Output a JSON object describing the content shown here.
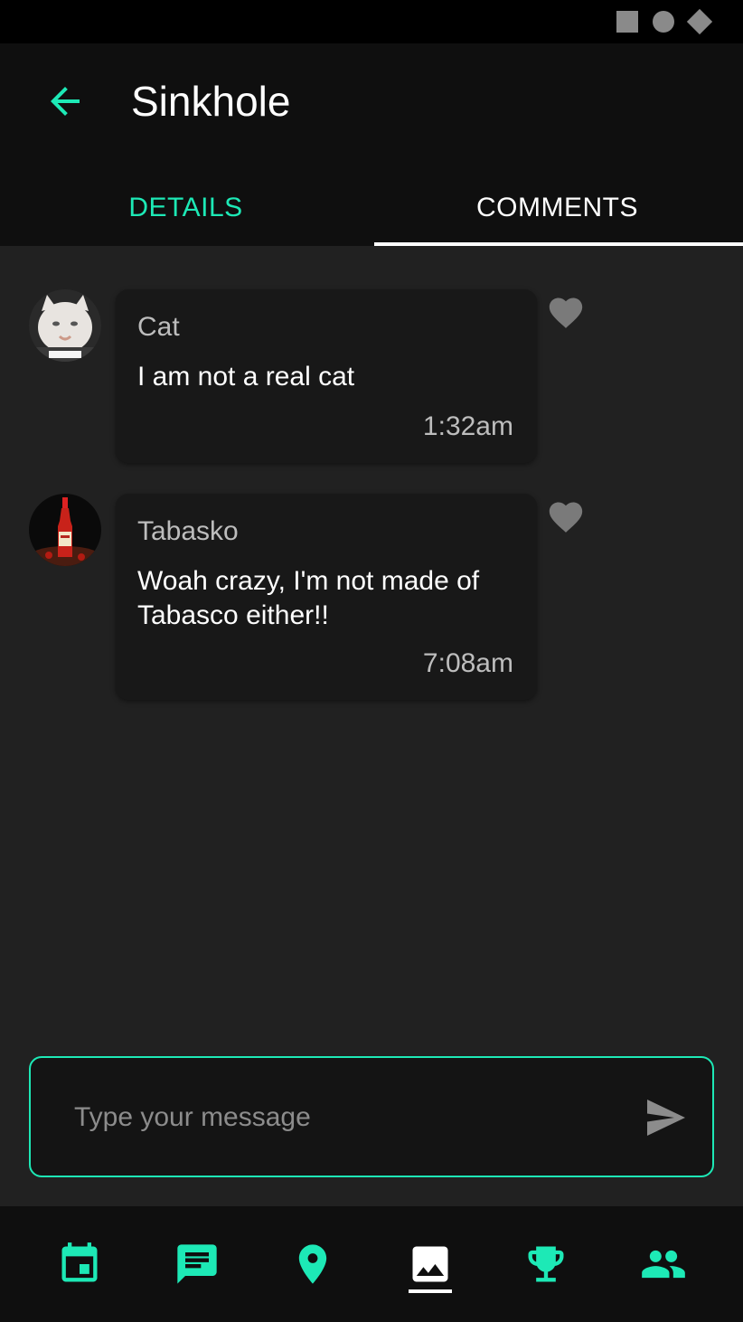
{
  "colors": {
    "accent": "#1de9b6",
    "background": "#212121",
    "card": "#181818",
    "bar": "#0f0f0f",
    "icon_muted": "#7a7a7a"
  },
  "header": {
    "title": "Sinkhole",
    "back_icon": "arrow-left-icon"
  },
  "tabs": [
    {
      "label": "DETAILS",
      "active": false
    },
    {
      "label": "COMMENTS",
      "active": true
    }
  ],
  "comments": [
    {
      "author": "Cat",
      "text": "I am not a real cat",
      "time": "1:32am",
      "avatar": "cat-avatar",
      "liked": false
    },
    {
      "author": "Tabasko",
      "text": "Woah crazy, I'm not made of Tabasco either!!",
      "time": "7:08am",
      "avatar": "tabasco-bottle-avatar",
      "liked": false
    }
  ],
  "composer": {
    "placeholder": "Type your message",
    "value": "",
    "send_icon": "send-icon"
  },
  "bottom_nav": [
    {
      "icon": "calendar-icon",
      "active": false
    },
    {
      "icon": "chat-icon",
      "active": false
    },
    {
      "icon": "location-pin-icon",
      "active": false
    },
    {
      "icon": "image-icon",
      "active": true
    },
    {
      "icon": "trophy-icon",
      "active": false
    },
    {
      "icon": "people-icon",
      "active": false
    }
  ]
}
